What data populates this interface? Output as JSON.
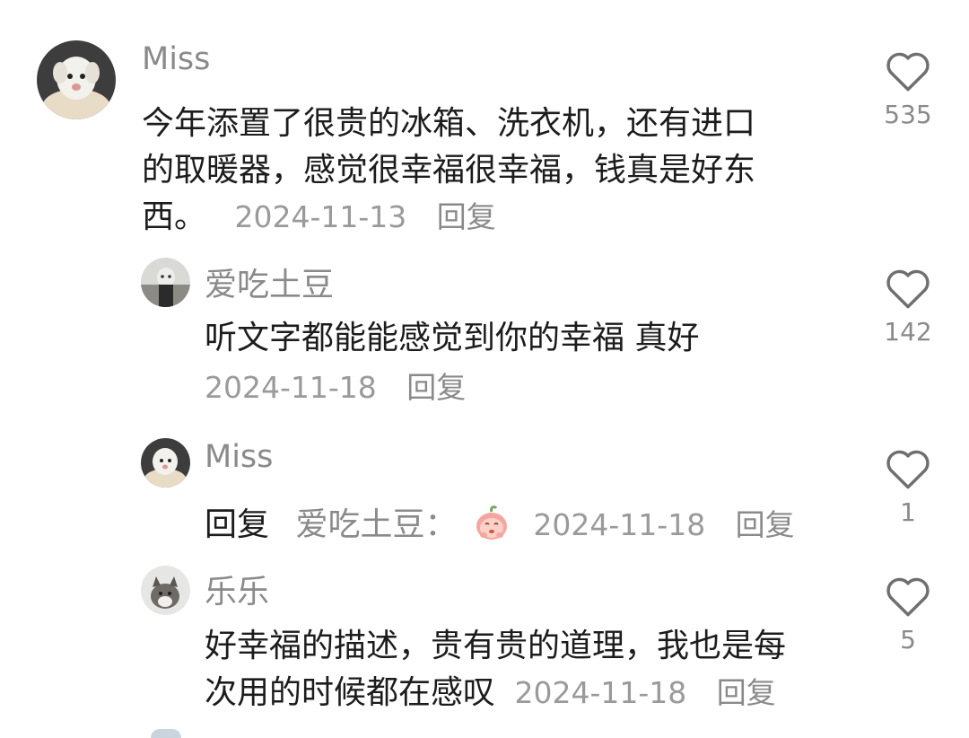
{
  "comments": [
    {
      "user": "Miss",
      "lines": [
        "今年添置了很贵的冰箱、洗衣机，还有进口",
        "的取暖器，感觉很幸福很幸福，钱真是好东",
        "西。"
      ],
      "date": "2024-11-13",
      "reply_label": "回复",
      "likes": "535"
    },
    {
      "user": "爱吃土豆",
      "lines": [
        "听文字都能能感觉到你的幸福 真好"
      ],
      "date": "2024-11-18",
      "reply_label": "回复",
      "likes": "142"
    },
    {
      "user": "Miss",
      "reply_prefix": "回复",
      "reply_to": "爱吃土豆",
      "colon": "：",
      "emoji": "peach-emoji",
      "date": "2024-11-18",
      "reply_label": "回复",
      "likes": "1"
    },
    {
      "user": "乐乐",
      "lines": [
        "好幸福的描述，贵有贵的道理，我也是每",
        "次用的时候都在感叹"
      ],
      "date": "2024-11-18",
      "reply_label": "回复",
      "likes": "5"
    }
  ],
  "icons": {
    "like": "heart-outline-icon"
  },
  "colors": {
    "name": "#8a8a8a",
    "text": "#1c1c1c",
    "meta": "#9a9a9a",
    "emoji": "#f4a6a0"
  }
}
